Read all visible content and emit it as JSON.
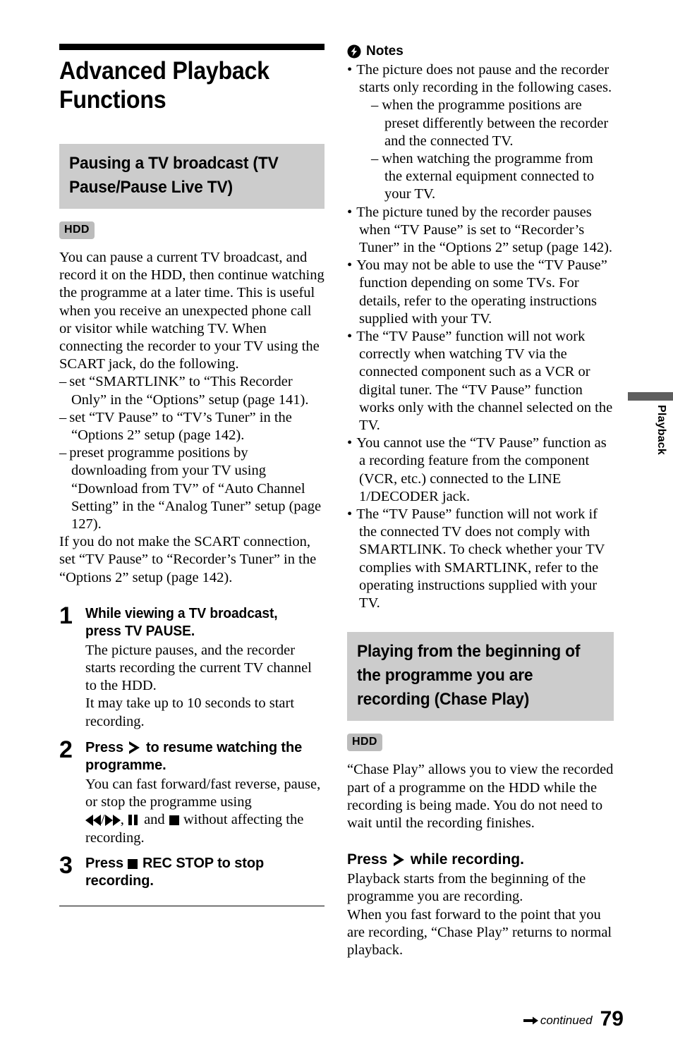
{
  "page": {
    "number": "79",
    "continued_label": "continued",
    "side_tab_label": "Playback",
    "colors": {
      "heading_band": "#cccccc",
      "badge": "#bcbcbc",
      "side_tab_bar": "#5e5e5e",
      "rule": "#000000"
    }
  },
  "chapter": {
    "title": "Advanced Playback Functions"
  },
  "left_column": {
    "section_heading": "Pausing a TV broadcast (TV Pause/Pause Live TV)",
    "media_badge": "HDD",
    "intro_paragraph": "You can pause a current TV broadcast, and record it on the HDD, then continue watching the programme at a later time. This is useful when you receive an unexpected phone call or visitor while watching TV. When connecting the recorder to your TV using the SCART jack, do the following.",
    "dash_items": [
      "set “SMARTLINK” to “This Recorder Only” in the “Options” setup (page 141).",
      "set “TV Pause” to “TV’s Tuner” in the “Options 2” setup (page 142).",
      "preset programme positions by downloading from your TV using “Download from TV” of “Auto Channel Setting” in the “Analog Tuner” setup (page 127)."
    ],
    "closing_paragraph": "If you do not make the SCART connection, set “TV Pause” to “Recorder’s Tuner” in the “Options 2” setup (page 142).",
    "steps": [
      {
        "number": "1",
        "title_before": "While viewing a TV broadcast, press TV PAUSE.",
        "title_after": "",
        "description": "The picture pauses, and the recorder starts recording the current TV channel to the HDD.\nIt may take up to 10 seconds to start recording."
      },
      {
        "number": "2",
        "title_before": "Press",
        "title_icon": "play-outline-icon",
        "title_after": "to resume watching the programme.",
        "desc_before": "You can fast forward/fast reverse, pause, or stop the programme using",
        "desc_icons": "fast-reverse-icon / fast-forward-icon , pause-icon and stop-icon",
        "desc_mid": ", ",
        "desc_and": " and ",
        "desc_after": "without affecting the recording."
      },
      {
        "number": "3",
        "title_before": "Press",
        "title_icon": "stop-icon",
        "title_after": "REC STOP to stop recording."
      }
    ]
  },
  "right_column": {
    "notes_heading": "Notes",
    "notes_icon": "lightning-bolt-icon",
    "notes": [
      {
        "text": "The picture does not pause and the recorder starts only recording in the following cases.",
        "subitems": [
          "when the programme positions are preset differently between the recorder and the connected TV.",
          "when watching the programme from the external equipment connected to your TV."
        ]
      },
      {
        "text": "The picture tuned by the recorder pauses when “TV Pause” is set to “Recorder’s Tuner” in the “Options 2” setup (page 142).",
        "subitems": []
      },
      {
        "text": "You may not be able to use the “TV Pause” function depending on some TVs. For details, refer to the operating instructions supplied with your TV.",
        "subitems": []
      },
      {
        "text": "The “TV Pause” function will not work correctly when watching TV via the connected component such as a VCR or digital tuner. The “TV Pause” function works only with the channel selected on the TV.",
        "subitems": []
      },
      {
        "text": "You cannot use the “TV Pause” function as a recording feature from the component (VCR, etc.) connected to the LINE 1/DECODER jack.",
        "subitems": []
      },
      {
        "text": "The “TV Pause” function will not work if the connected TV does not comply with SMARTLINK. To check whether your TV complies with SMARTLINK, refer to the operating instructions supplied with your TV.",
        "subitems": []
      }
    ],
    "section_heading": "Playing from the beginning of the programme you are recording (Chase Play)",
    "media_badge": "HDD",
    "intro_paragraph": "“Chase Play” allows you to view the recorded part of a programme on the HDD while the recording is being made. You do not need to wait until the recording finishes.",
    "sub_head_before": "Press",
    "sub_head_icon": "play-outline-icon",
    "sub_head_after": "while recording.",
    "body_paragraph": "Playback starts from the beginning of the programme you are recording.\nWhen you fast forward to the point that you are recording, “Chase Play” returns to normal playback."
  }
}
